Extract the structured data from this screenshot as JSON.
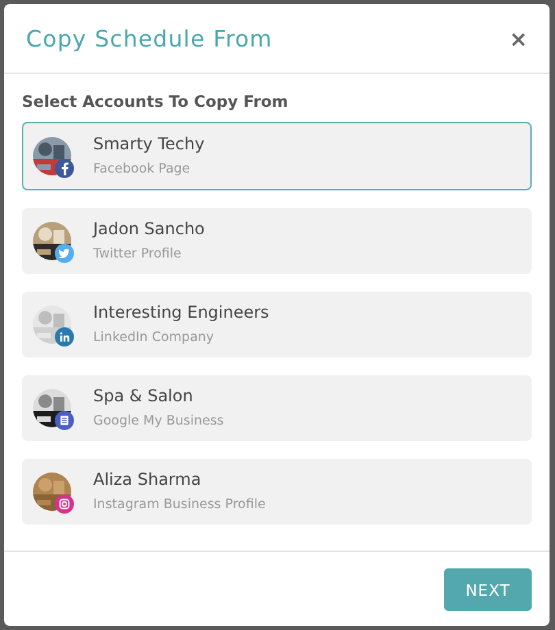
{
  "dialog": {
    "title": "Copy Schedule From",
    "close": "×"
  },
  "section_label": "Select Accounts To Copy From",
  "accounts": [
    {
      "name": "Smarty Techy",
      "type": "Facebook Page",
      "kind": "facebook",
      "selected": true
    },
    {
      "name": "Jadon Sancho",
      "type": "Twitter Profile",
      "kind": "twitter",
      "selected": false
    },
    {
      "name": "Interesting Engineers",
      "type": "LinkedIn Company",
      "kind": "linkedin",
      "selected": false
    },
    {
      "name": "Spa & Salon",
      "type": "Google My Business",
      "kind": "gmb",
      "selected": false
    },
    {
      "name": "Aliza Sharma",
      "type": "Instagram Business Profile",
      "kind": "instagram",
      "selected": false
    }
  ],
  "buttons": [
    {
      "label": "NEXT"
    }
  ]
}
